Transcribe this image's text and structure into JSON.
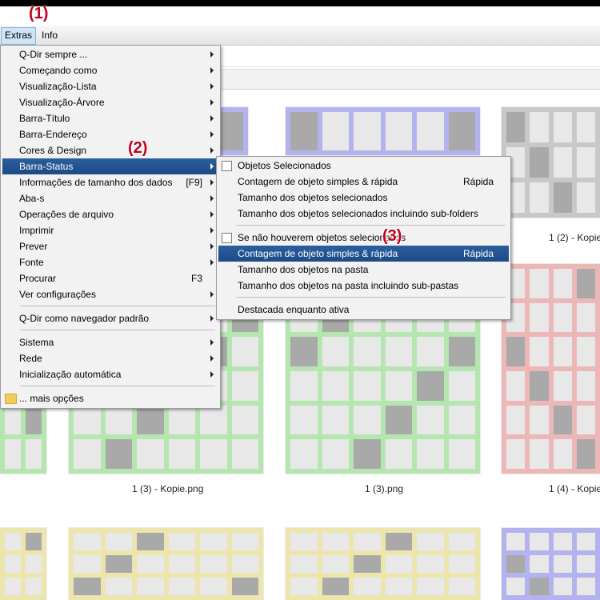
{
  "menubar": {
    "extras": "Extras",
    "info": "Info"
  },
  "callouts": [
    "(1)",
    "(2)",
    "(3)"
  ],
  "extras_menu": {
    "items": [
      {
        "label": "Q-Dir sempre ...",
        "shortcut": "",
        "submenu": true
      },
      {
        "label": "Começando como",
        "shortcut": "",
        "submenu": true
      },
      {
        "label": "Visualização-Lista",
        "shortcut": "",
        "submenu": true
      },
      {
        "label": "Visualização-Árvore",
        "shortcut": "",
        "submenu": true
      },
      {
        "label": "Barra-Título",
        "shortcut": "",
        "submenu": true
      },
      {
        "label": "Barra-Endereço",
        "shortcut": "",
        "submenu": true
      },
      {
        "label": "Cores & Design",
        "shortcut": "",
        "submenu": true
      },
      {
        "label": "Barra-Status",
        "shortcut": "",
        "submenu": true,
        "highlighted": true
      },
      {
        "label": "Informações de tamanho dos dados",
        "shortcut": "[F9]",
        "submenu": true
      },
      {
        "label": "Aba-s",
        "shortcut": "",
        "submenu": true
      },
      {
        "label": "Operações de arquivo",
        "shortcut": "",
        "submenu": true
      },
      {
        "label": "Imprimir",
        "shortcut": "",
        "submenu": true
      },
      {
        "label": "Prever",
        "shortcut": "",
        "submenu": true
      },
      {
        "label": "Fonte",
        "shortcut": "",
        "submenu": true
      },
      {
        "label": "Procurar",
        "shortcut": "F3",
        "submenu": false
      },
      {
        "label": "Ver configurações",
        "shortcut": "",
        "submenu": true
      },
      {
        "label": "Q-Dir como navegador padrão",
        "shortcut": "",
        "submenu": true
      },
      {
        "label": "Sistema",
        "shortcut": "",
        "submenu": true
      },
      {
        "label": "Rede",
        "shortcut": "",
        "submenu": true
      },
      {
        "label": "Inicialização automática",
        "shortcut": "",
        "submenu": true
      },
      {
        "label": "... mais opções",
        "shortcut": "",
        "submenu": false,
        "icon": "folder-icon"
      }
    ]
  },
  "status_submenu": {
    "items": [
      {
        "label": "Objetos Selecionados",
        "shortcut": "",
        "checkbox": true
      },
      {
        "label": "Contagem de objeto simples & rápida",
        "shortcut": "Rápida"
      },
      {
        "label": "Tamanho dos objetos selecionados",
        "shortcut": ""
      },
      {
        "label": "Tamanho dos objetos selecionados incluindo sub-folders",
        "shortcut": ""
      },
      {
        "label": "Se não houverem objetos selecionados",
        "shortcut": "",
        "checkbox": true
      },
      {
        "label": "Contagem de objeto simples & rápida",
        "shortcut": "Rápida",
        "highlighted": true
      },
      {
        "label": "Tamanho dos objetos na pasta",
        "shortcut": ""
      },
      {
        "label": "Tamanho dos objetos na pasta incluindo sub-pastas",
        "shortcut": ""
      },
      {
        "label": "Destacada enquanto ativa",
        "shortcut": ""
      }
    ]
  },
  "files": [
    {
      "name": "1 (2) - Kopie",
      "accent": "#c8c8c8"
    },
    {
      "name": "1 (3) - Kopie.png",
      "accent": "#b6e6b0"
    },
    {
      "name": "1 (3).png",
      "accent": "#b6e6b0"
    },
    {
      "name": "1 (4) - Kopie",
      "accent": "#ecb7b7"
    },
    {
      "name": "",
      "accent": "#b6e6b0"
    },
    {
      "name": "",
      "accent": "#b3b3ee"
    },
    {
      "name": "",
      "accent": "#ece5ad"
    },
    {
      "name": "",
      "accent": "#ece5ad"
    },
    {
      "name": "",
      "accent": "#ece5ad"
    },
    {
      "name": "",
      "accent": "#b3b3ee"
    }
  ],
  "colors": {
    "highlight": "#1c4b86",
    "callout": "#c0001c"
  }
}
